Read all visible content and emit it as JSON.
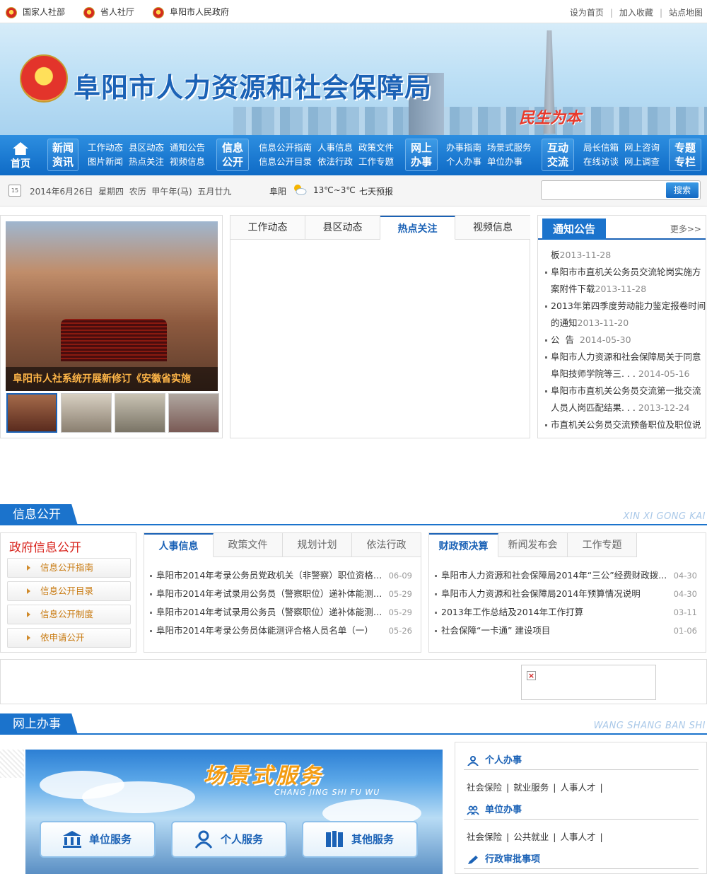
{
  "topbar": {
    "links": [
      "国家人社部",
      "省人社厅",
      "阜阳市人民政府"
    ],
    "right": [
      "设为首页",
      "加入收藏",
      "站点地图"
    ]
  },
  "banner": {
    "site_name": "阜阳市人力资源和社会保障局",
    "slogan": "民生为本"
  },
  "nav": {
    "home": "首页",
    "groups": [
      {
        "title": [
          "新闻",
          "资讯"
        ],
        "links": [
          [
            "工作动态",
            "县区动态",
            "通知公告"
          ],
          [
            "图片新闻",
            "热点关注",
            "视频信息"
          ]
        ]
      },
      {
        "title": [
          "信息",
          "公开"
        ],
        "links": [
          [
            "信息公开指南",
            "人事信息",
            "政策文件"
          ],
          [
            "信息公开目录",
            "依法行政",
            "工作专题"
          ]
        ]
      },
      {
        "title": [
          "网上",
          "办事"
        ],
        "links": [
          [
            "办事指南",
            "场景式服务"
          ],
          [
            "个人办事",
            "单位办事"
          ]
        ]
      },
      {
        "title": [
          "互动",
          "交流"
        ],
        "links": [
          [
            "局长信箱",
            "网上咨询"
          ],
          [
            "在线访谈",
            "网上调查"
          ]
        ]
      },
      {
        "title": [
          "专题",
          "专栏"
        ],
        "links": []
      }
    ]
  },
  "datebar": {
    "cal": "15",
    "date": "2014年6月26日  星期四  农历  甲午年(马)  五月廿九",
    "city": "阜阳",
    "temp": "13℃~3℃",
    "forecast": "七天预报",
    "search_label": "搜索"
  },
  "carousel": {
    "caption": "阜阳市人社系统开展新修订《安徽省实施"
  },
  "tabs": [
    "工作动态",
    "县区动态",
    "热点关注",
    "视频信息"
  ],
  "notice": {
    "title": "通知公告",
    "more": "更多>>",
    "lines": [
      {
        "text": "板",
        "date": "2013-11-28",
        "bullet": false
      },
      {
        "text": "阜阳市市直机关公务员交流轮岗实施方",
        "date": "",
        "bullet": true
      },
      {
        "text": "案附件下载",
        "date": "2013-11-28",
        "bullet": false
      },
      {
        "text": "2013年第四季度劳动能力鉴定报卷时间",
        "date": "",
        "bullet": true
      },
      {
        "text": "的通知",
        "date": "2013-11-20",
        "bullet": false
      },
      {
        "text": "公  告  ",
        "date": "2014-05-30",
        "bullet": true
      },
      {
        "text": "阜阳市人力资源和社会保障局关于同意",
        "date": "",
        "bullet": true
      },
      {
        "text": "阜阳技师学院等三. . . ",
        "date": "2014-05-16",
        "bullet": false
      },
      {
        "text": "阜阳市市直机关公务员交流第一批交流",
        "date": "",
        "bullet": true
      },
      {
        "text": "人员人岗匹配结果. . . ",
        "date": "2013-12-24",
        "bullet": false
      },
      {
        "text": "市直机关公务员交流预备职位及职位说",
        "date": "",
        "bullet": true
      }
    ]
  },
  "sec_info": {
    "title": "信息公开",
    "pinyin": "XIN XI GONG KAI"
  },
  "gov": {
    "title": "政府信息公开",
    "buttons": [
      "信息公开指南",
      "信息公开目录",
      "信息公开制度",
      "依申请公开"
    ]
  },
  "hr_list": {
    "tabs": [
      "人事信息",
      "政策文件",
      "规划计划",
      "依法行政"
    ],
    "items": [
      {
        "text": "阜阳市2014年考录公务员党政机关（非警察）职位资格复...",
        "date": "06-09"
      },
      {
        "text": "阜阳市2014年考试录用公务员（警察职位）递补体能测评...",
        "date": "05-29"
      },
      {
        "text": "阜阳市2014年考试录用公务员（警察职位）递补体能测评...",
        "date": "05-29"
      },
      {
        "text": "阜阳市2014年考录公务员体能测评合格人员名单（一）",
        "date": "05-26"
      }
    ]
  },
  "fin_list": {
    "tabs": [
      "财政预决算",
      "新闻发布会",
      "工作专题"
    ],
    "items": [
      {
        "text": "阜阳市人力资源和社会保障局2014年“三公”经费财政拨...",
        "date": "04-30"
      },
      {
        "text": "阜阳市人力资源和社会保障局2014年预算情况说明",
        "date": "04-30"
      },
      {
        "text": "2013年工作总结及2014年工作打算",
        "date": "03-11"
      },
      {
        "text": "社会保障“一卡通” 建设项目",
        "date": "01-06"
      }
    ]
  },
  "sec_online": {
    "title": "网上办事",
    "pinyin": "WANG SHANG BAN SHI"
  },
  "scene": {
    "title": "场景式服务",
    "subtitle": "CHANG JING SHI FU WU",
    "buttons": [
      "单位服务",
      "个人服务",
      "其他服务"
    ]
  },
  "service_side": {
    "personal": {
      "title": "个人办事",
      "links": [
        "社会保险",
        "就业服务",
        "人事人才"
      ]
    },
    "unit": {
      "title": "单位办事",
      "links": [
        "社会保险",
        "公共就业",
        "人事人才"
      ]
    },
    "admin": {
      "title": "行政审批事项"
    }
  }
}
